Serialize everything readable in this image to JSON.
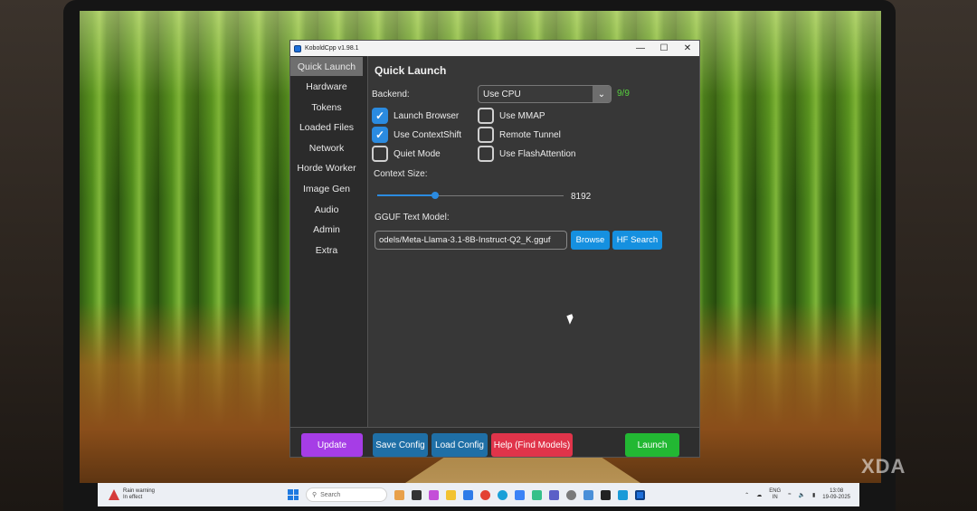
{
  "window": {
    "title": "KoboldCpp v1.98.1",
    "controls": {
      "minimize": "—",
      "maximize": "☐",
      "close": "✕"
    }
  },
  "sidebar": {
    "items": [
      {
        "label": "Quick Launch",
        "active": true
      },
      {
        "label": "Hardware"
      },
      {
        "label": "Tokens"
      },
      {
        "label": "Loaded Files"
      },
      {
        "label": "Network"
      },
      {
        "label": "Horde Worker"
      },
      {
        "label": "Image Gen"
      },
      {
        "label": "Audio"
      },
      {
        "label": "Admin"
      },
      {
        "label": "Extra"
      }
    ]
  },
  "main": {
    "heading": "Quick Launch",
    "backend": {
      "label": "Backend:",
      "value": "Use CPU",
      "count": "9/9"
    },
    "checkboxes": [
      {
        "label": "Launch Browser",
        "checked": true
      },
      {
        "label": "Use ContextShift",
        "checked": true
      },
      {
        "label": "Quiet Mode",
        "checked": false
      },
      {
        "label": "Use MMAP",
        "checked": false
      },
      {
        "label": "Remote Tunnel",
        "checked": false
      },
      {
        "label": "Use FlashAttention",
        "checked": false
      }
    ],
    "context": {
      "label": "Context Size:",
      "value": "8192",
      "slider_fraction": 0.31
    },
    "model": {
      "label": "GGUF Text Model:",
      "path": "odels/Meta-Llama-3.1-8B-Instruct-Q2_K.gguf",
      "browse": "Browse",
      "hf_search": "HF Search"
    }
  },
  "footer": {
    "update": "Update",
    "save_config": "Save Config",
    "load_config": "Load Config",
    "help": "Help (Find Models)",
    "launch": "Launch"
  },
  "taskbar": {
    "weather_title": "Rain warning",
    "weather_sub": "In effect",
    "search": "Search",
    "lang_1": "ENG",
    "lang_2": "IN",
    "time": "13:08",
    "date": "19-09-2025"
  },
  "watermark": "XDA",
  "colors": {
    "accent_blue": "#1590e0",
    "update_purple": "#a63de6",
    "help_red": "#e0344a",
    "launch_green": "#22b833",
    "count_green": "#57d13e"
  }
}
